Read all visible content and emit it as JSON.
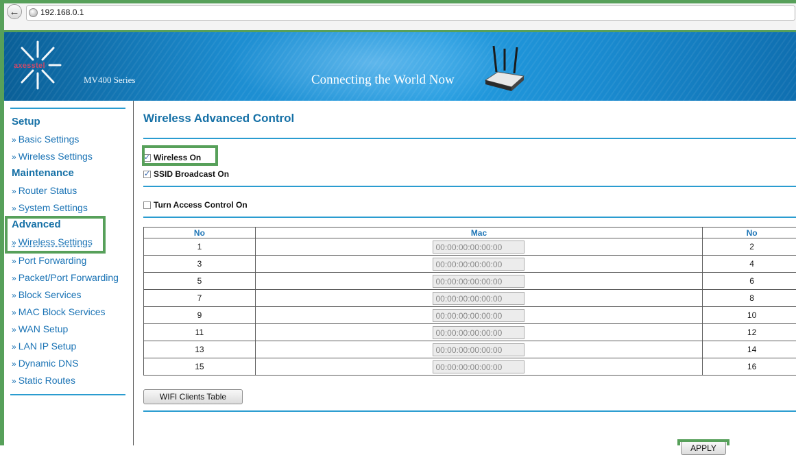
{
  "browser": {
    "url": "192.168.0.1"
  },
  "banner": {
    "logo_text": "axesstel",
    "series": "MV400 Series",
    "tagline": "Connecting the World Now"
  },
  "sidebar": {
    "sections": [
      {
        "title": "Setup",
        "items": [
          "Basic Settings",
          "Wireless Settings"
        ]
      },
      {
        "title": "Maintenance",
        "items": [
          "Router Status",
          "System Settings"
        ]
      },
      {
        "title": "Advanced",
        "items": [
          "Wireless Settings",
          "Port Forwarding",
          "Packet/Port Forwarding",
          "Block Services",
          "MAC Block Services",
          "WAN Setup",
          "LAN IP Setup",
          "Dynamic DNS",
          "Static Routes"
        ]
      }
    ],
    "active_item": "Wireless Settings"
  },
  "main": {
    "title": "Wireless Advanced Control",
    "checkboxes": {
      "wireless_on": {
        "label": "Wireless On",
        "checked": true
      },
      "ssid_broadcast": {
        "label": "SSID Broadcast On",
        "checked": true
      },
      "access_control": {
        "label": "Turn Access Control On",
        "checked": false
      }
    },
    "table": {
      "headers": [
        "No",
        "Mac",
        "No"
      ],
      "rows": [
        {
          "no_left": "1",
          "mac": "00:00:00:00:00:00",
          "no_right": "2"
        },
        {
          "no_left": "3",
          "mac": "00:00:00:00:00:00",
          "no_right": "4"
        },
        {
          "no_left": "5",
          "mac": "00:00:00:00:00:00",
          "no_right": "6"
        },
        {
          "no_left": "7",
          "mac": "00:00:00:00:00:00",
          "no_right": "8"
        },
        {
          "no_left": "9",
          "mac": "00:00:00:00:00:00",
          "no_right": "10"
        },
        {
          "no_left": "11",
          "mac": "00:00:00:00:00:00",
          "no_right": "12"
        },
        {
          "no_left": "13",
          "mac": "00:00:00:00:00:00",
          "no_right": "14"
        },
        {
          "no_left": "15",
          "mac": "00:00:00:00:00:00",
          "no_right": "16"
        }
      ]
    },
    "wifi_clients_button": "WIFI Clients Table",
    "apply_button": "APPLY"
  },
  "colors": {
    "accent_blue": "#1570a6",
    "link_blue": "#1a73b5",
    "rule_blue": "#2a9cd0",
    "highlight_green": "#57a05a",
    "banner_blue": "#1d8ed2"
  }
}
